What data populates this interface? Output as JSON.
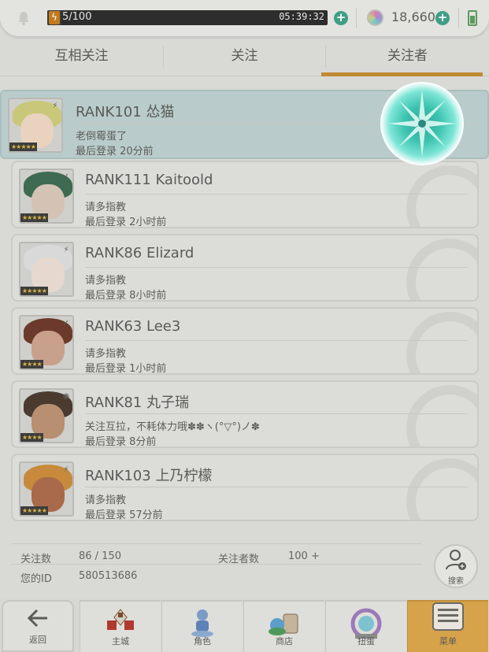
{
  "status": {
    "stamina_text": "5/100",
    "stamina_fraction": 0.05,
    "timer": "05:39:32",
    "gem_count": "18,660"
  },
  "tabs": [
    {
      "label": "互相关注"
    },
    {
      "label": "关注"
    },
    {
      "label": "关注者",
      "active": true
    }
  ],
  "followers": [
    {
      "name": "RANK101 怂猫",
      "message": "老倒霉蛋了",
      "last_login": "最后登录 20分前",
      "stars": "★★★★★",
      "badge": "⚡",
      "hair": "#c8c77a",
      "face": "#e9d2be"
    },
    {
      "name": "RANK111 Kaitoold",
      "message": "请多指教",
      "last_login": "最后登录 2小时前",
      "stars": "★★★★★",
      "badge": "✓",
      "hair": "#3f6a52",
      "face": "#d4c3b4"
    },
    {
      "name": "RANK86 Elizard",
      "message": "请多指教",
      "last_login": "最后登录 8小时前",
      "stars": "★★★★★",
      "badge": "⚡",
      "hair": "#d9d9d9",
      "face": "#e7d8cf"
    },
    {
      "name": "RANK63 Lee3",
      "message": "请多指教",
      "last_login": "最后登录 1小时前",
      "stars": "★★★★",
      "badge": "✓",
      "hair": "#6b3a2c",
      "face": "#c9a08b"
    },
    {
      "name": "RANK81 丸子瑞",
      "message": "关注互拉，不耗体力哦✽✽ヽ(°▽°)ノ✽",
      "last_login": "最后登录 8分前",
      "stars": "★★★★",
      "badge": "◉",
      "hair": "#4a3a2f",
      "face": "#b88f70"
    },
    {
      "name": "RANK103 上乃柠檬",
      "message": "请多指教",
      "last_login": "最后登录 57分前",
      "stars": "★★★★★",
      "badge": "⚡",
      "hair": "#c78a3c",
      "face": "#a86a4a"
    }
  ],
  "info": {
    "follow_count_label": "关注数",
    "follow_count_value": "86 / 150",
    "follower_count_label": "关注者数",
    "follower_count_value": "100 +",
    "id_label": "您的ID",
    "id_value": "580513686"
  },
  "search_label": "搜索",
  "nav": {
    "back": "返回",
    "items": [
      {
        "label": "主城"
      },
      {
        "label": "角色"
      },
      {
        "label": "商店"
      },
      {
        "label": "扭蛋"
      },
      {
        "label": "菜单",
        "active": true
      }
    ]
  },
  "colors": {
    "accent": "#c08a34",
    "menu_active": "#d6a24a",
    "highlight_row": "#b9cccb",
    "burst": "#3cc3b0"
  }
}
